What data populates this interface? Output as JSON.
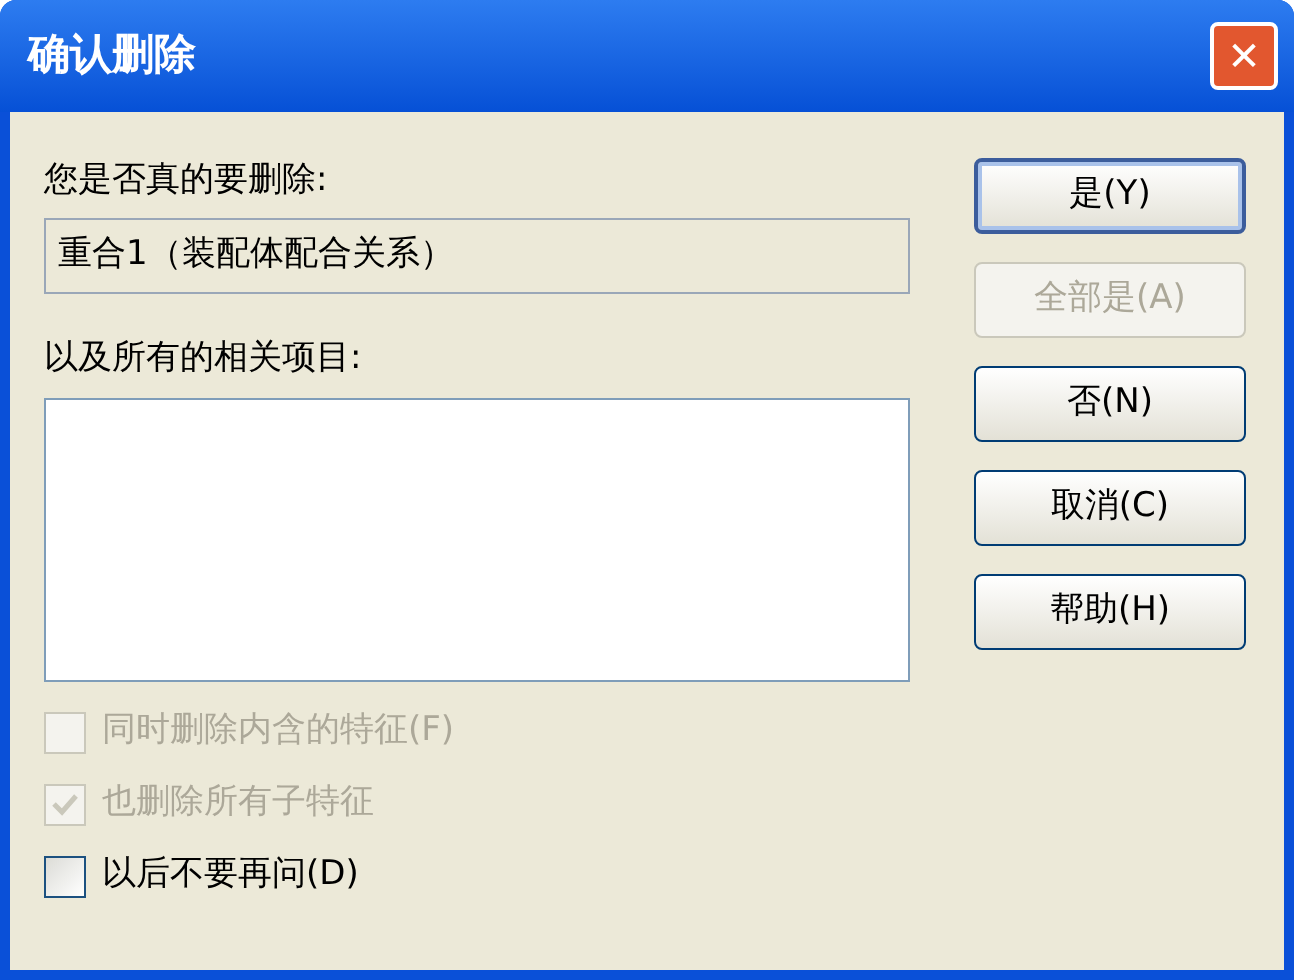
{
  "window": {
    "title": "确认删除",
    "close": "✕"
  },
  "prompt": "您是否真的要删除:",
  "item": "重合1（装配体配合关系）",
  "related_label": "以及所有的相关项目:",
  "options": [
    {
      "label": "同时删除内含的特征(F)",
      "checked": false,
      "disabled": true
    },
    {
      "label": "也删除所有子特征",
      "checked": true,
      "disabled": true
    },
    {
      "label": "以后不要再问(D)",
      "checked": false,
      "disabled": false
    }
  ],
  "buttons": [
    {
      "label": "是(Y)",
      "default": true,
      "disabled": false
    },
    {
      "label": "全部是(A)",
      "default": false,
      "disabled": true
    },
    {
      "label": "否(N)",
      "default": false,
      "disabled": false
    },
    {
      "label": "取消(C)",
      "default": false,
      "disabled": false
    },
    {
      "label": "帮助(H)",
      "default": false,
      "disabled": false
    }
  ]
}
